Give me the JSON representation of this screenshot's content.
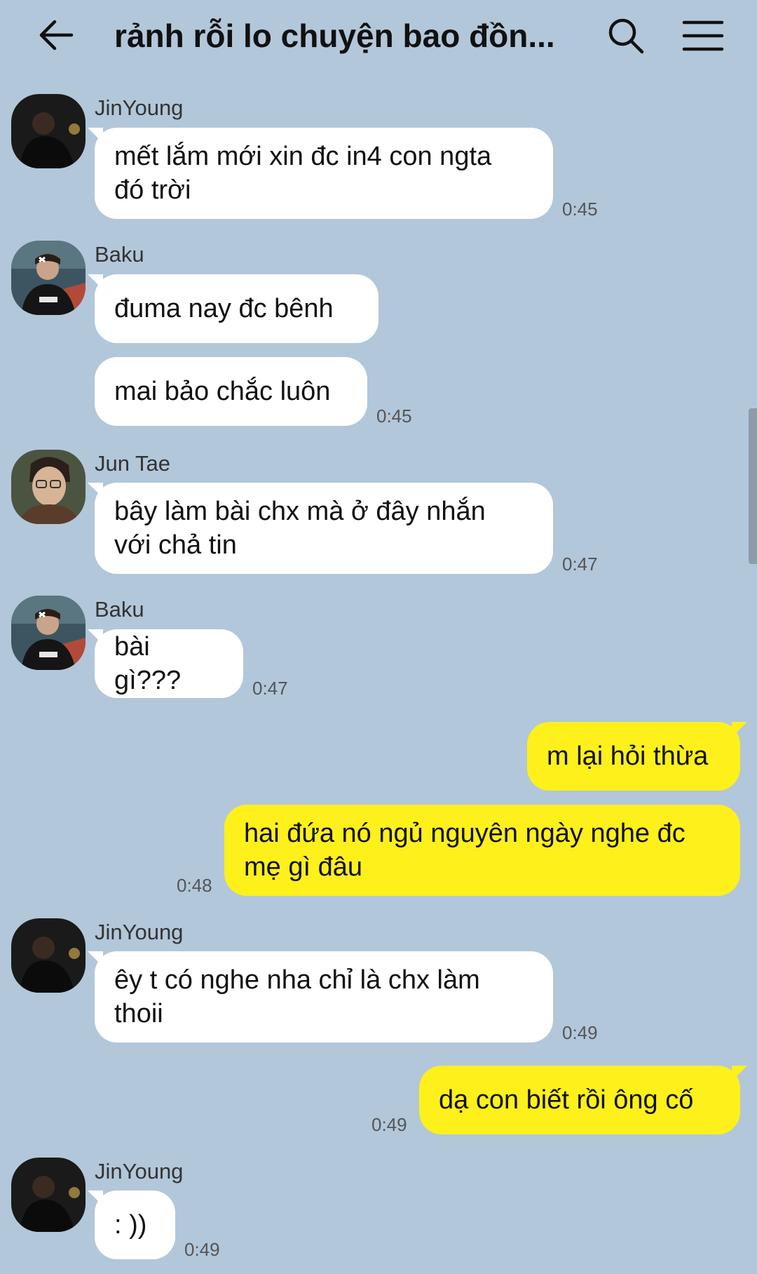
{
  "header": {
    "title": "rảnh rỗi lo chuyện bao đồn...",
    "back_icon": "arrow-left-icon",
    "search_icon": "search-icon",
    "menu_icon": "hamburger-menu-icon"
  },
  "colors": {
    "background": "#b2c7da",
    "incoming_bubble": "#ffffff",
    "outgoing_bubble": "#fef01b"
  },
  "messages": [
    {
      "sender": "JinYoung",
      "text_lines": [
        "mết lắm mới xin đc in4 con ngta",
        "đó trời"
      ],
      "time": "0:45"
    },
    {
      "sender": "Baku",
      "text": "đuma nay đc bênh"
    },
    {
      "text": "mai bảo chắc luôn",
      "time": "0:45"
    },
    {
      "sender": "Jun Tae",
      "text_lines": [
        "bây làm bài chx mà ở đây nhắn",
        "với chả tin"
      ],
      "time": "0:47"
    },
    {
      "sender": "Baku",
      "text": "bài gì???",
      "time": "0:47"
    },
    {
      "from_me": true,
      "text": "m lại hỏi thừa"
    },
    {
      "from_me": true,
      "text_lines": [
        "hai đứa nó ngủ nguyên ngày nghe đc",
        "mẹ gì đâu"
      ],
      "time": "0:48"
    },
    {
      "sender": "JinYoung",
      "text_lines": [
        "êy t có nghe nha chỉ là chx làm",
        "thoii"
      ],
      "time": "0:49"
    },
    {
      "from_me": true,
      "text": "dạ con biết rồi ông cố",
      "time": "0:49"
    },
    {
      "sender": "JinYoung",
      "text": ": ))",
      "time": "0:49"
    }
  ]
}
